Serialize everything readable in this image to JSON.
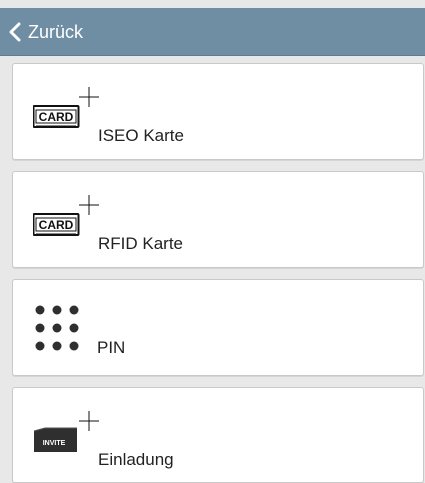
{
  "header": {
    "back_label": "Zurück",
    "back_icon": "chevron-left-icon",
    "bar_color": "#6f8ea3"
  },
  "options": [
    {
      "id": "iseo-card",
      "label": "ISEO Karte",
      "icon": "card-add-icon",
      "icon_text": "CARD"
    },
    {
      "id": "rfid-card",
      "label": "RFID Karte",
      "icon": "card-add-icon",
      "icon_text": "CARD"
    },
    {
      "id": "pin",
      "label": "PIN",
      "icon": "keypad-dots-icon"
    },
    {
      "id": "invitation",
      "label": "Einladung",
      "icon": "invite-add-icon",
      "icon_text": "INVITE"
    }
  ]
}
